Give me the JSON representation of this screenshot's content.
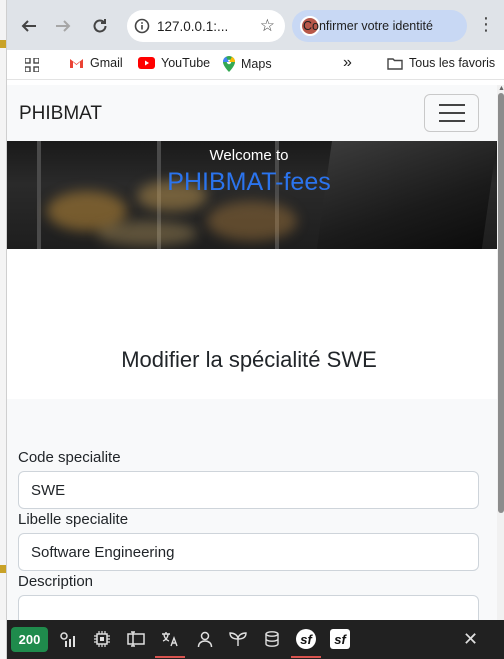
{
  "browser": {
    "url": "127.0.0.1:...",
    "identity_label": "Confirmer votre identité",
    "bookmarks": [
      {
        "label": "Gmail",
        "icon": "gmail-icon"
      },
      {
        "label": "YouTube",
        "icon": "youtube-icon"
      },
      {
        "label": "Maps",
        "icon": "maps-icon"
      }
    ],
    "bookmarks_overflow": "»",
    "all_bookmarks_label": "Tous les favoris"
  },
  "navbar": {
    "brand": "PHIBMAT"
  },
  "hero": {
    "welcome": "Welcome to",
    "app_name": "PHIBMAT-fees",
    "app_color": "#2b74ee"
  },
  "page": {
    "title": "Modifier la spécialité SWE",
    "form": {
      "code_label": "Code specialite",
      "code_value": "SWE",
      "libelle_label": "Libelle specialite",
      "libelle_value": "Software Engineering",
      "description_label": "Description",
      "description_value": ""
    }
  },
  "debugbar": {
    "status_code": "200",
    "status_color": "#1f8b4c",
    "close": "✕"
  }
}
